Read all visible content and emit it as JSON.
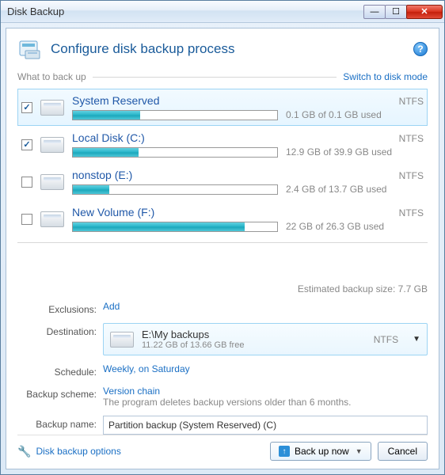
{
  "window": {
    "title": "Disk Backup"
  },
  "header": {
    "title": "Configure disk backup process"
  },
  "section": {
    "what_to_backup": "What to back up",
    "switch_link": "Switch to disk mode"
  },
  "volumes": [
    {
      "name": "System Reserved",
      "fs": "NTFS",
      "usage": "0.1 GB of 0.1 GB used",
      "pct": 33,
      "checked": true,
      "selected": true
    },
    {
      "name": "Local Disk (C:)",
      "fs": "NTFS",
      "usage": "12.9 GB of 39.9 GB used",
      "pct": 32,
      "checked": true,
      "selected": false
    },
    {
      "name": "nonstop (E:)",
      "fs": "NTFS",
      "usage": "2.4 GB of 13.7 GB used",
      "pct": 18,
      "checked": false,
      "selected": false
    },
    {
      "name": "New Volume (F:)",
      "fs": "NTFS",
      "usage": "22 GB of 26.3 GB used",
      "pct": 84,
      "checked": false,
      "selected": false
    }
  ],
  "estimate": {
    "label": "Estimated backup size:",
    "value": "7.7 GB"
  },
  "form": {
    "exclusions_label": "Exclusions:",
    "exclusions_link": "Add",
    "destination_label": "Destination:",
    "destination": {
      "path": "E:\\My backups",
      "free": "11.22 GB of 13.66 GB free",
      "fs": "NTFS"
    },
    "schedule_label": "Schedule:",
    "schedule_value": "Weekly, on Saturday",
    "scheme_label": "Backup scheme:",
    "scheme_value": "Version chain",
    "scheme_desc": "The program deletes backup versions older than 6 months.",
    "name_label": "Backup name:",
    "name_value": "Partition backup (System Reserved) (C)"
  },
  "footer": {
    "options_link": "Disk backup options",
    "backup_btn": "Back up now",
    "cancel_btn": "Cancel"
  }
}
